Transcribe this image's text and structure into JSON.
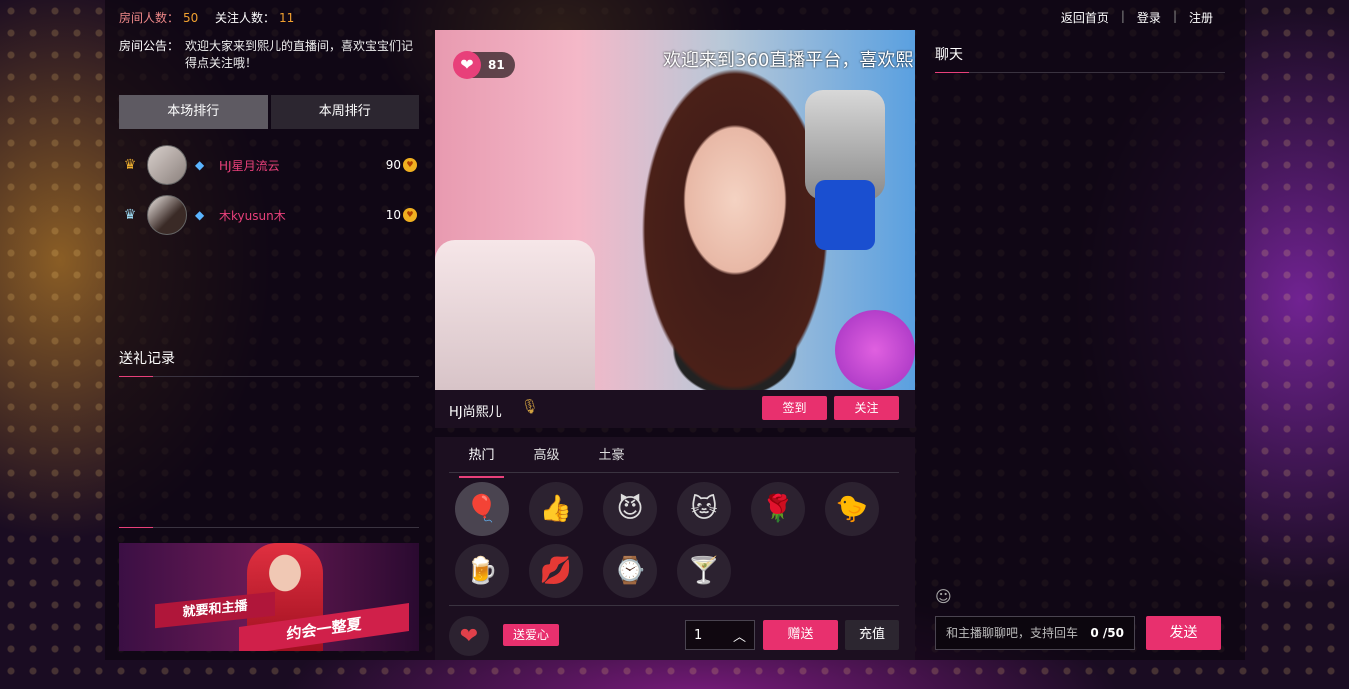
{
  "topbar": {
    "room_count_label": "房间人数：",
    "room_count_value": "50",
    "follow_count_label": "关注人数：",
    "follow_count_value": "11",
    "nav": [
      "返回首页",
      "登录",
      "注册"
    ]
  },
  "notice": {
    "label": "房间公告：",
    "text": "欢迎大家来到熙儿的直播间，喜欢宝宝们记得点关注哦！"
  },
  "ranking": {
    "tabs": [
      "本场排行",
      "本周排行"
    ],
    "rows": [
      {
        "rank_icon": "gold-crown-icon",
        "name": "HJ星月流云",
        "score": "90"
      },
      {
        "rank_icon": "silver-crown-icon",
        "name": "木kyusun木",
        "score": "10"
      }
    ]
  },
  "gift_record": {
    "title": "送礼记录"
  },
  "banner": {
    "line1": "就要和主播",
    "line2": "约会一整夏"
  },
  "video": {
    "marquee": "欢迎来到360直播平台，喜欢熙",
    "likes": "81"
  },
  "anchor": {
    "name": "HJ尚熙儿",
    "checkin_label": "签到",
    "follow_label": "关注"
  },
  "gifts": {
    "tabs": [
      "热门",
      "高级",
      "土豪"
    ],
    "items": [
      "balloons-gift-icon",
      "thumbs-up-gift-icon",
      "devil-gift-icon",
      "cat-ears-gift-icon",
      "rose-gift-icon",
      "chick-gift-icon",
      "beer-gift-icon",
      "lips-gift-icon",
      "watch-gift-icon",
      "cocktail-gift-icon"
    ],
    "love_label": "送爱心",
    "quantity": "1",
    "send_label": "赠送",
    "recharge_label": "充值"
  },
  "chat": {
    "title": "聊天",
    "placeholder": "和主播聊聊吧，支持回车",
    "counter": "0 /50",
    "send_label": "发送"
  },
  "colors": {
    "accent": "#e8306e",
    "highlight": "#f0a030"
  }
}
